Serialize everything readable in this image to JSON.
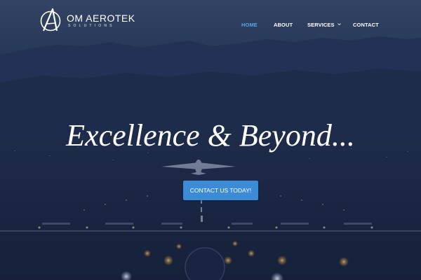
{
  "brand": {
    "name": "OM AEROTEK",
    "tagline": "SOLUTIONS",
    "icon": "logo-a-circle-icon"
  },
  "nav": {
    "items": [
      {
        "label": "HOME",
        "active": true
      },
      {
        "label": "ABOUT",
        "active": false
      },
      {
        "label": "SERVICES",
        "active": false,
        "has_dropdown": true
      },
      {
        "label": "CONTACT",
        "active": false
      }
    ]
  },
  "hero": {
    "title": "Excellence & Beyond...",
    "cta_label": "CONTACT US TODAY!",
    "background": "airport-runway-at-night-photo"
  },
  "colors": {
    "accent": "#3c8bd6",
    "nav_active": "#5aa6e6",
    "overlay": "#1b2844"
  }
}
